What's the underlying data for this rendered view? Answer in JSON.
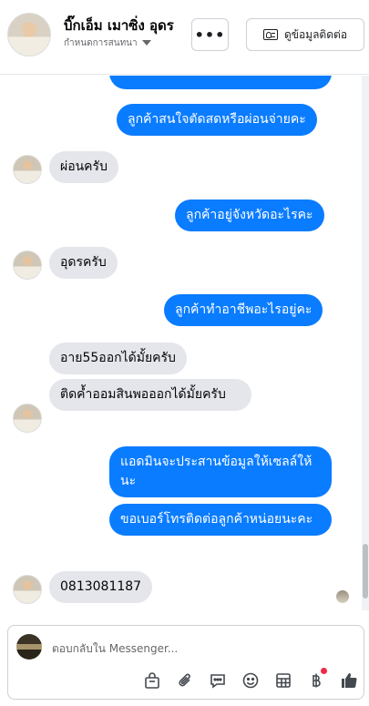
{
  "header": {
    "name": "บิ๊กเอ็ม เมาซิ่ง อุดร",
    "status": "กำหนดการสนทนา",
    "more_label": "•••",
    "contact_label": "ดูข้อมูลติดต่อ"
  },
  "messages": [
    {
      "dir": "out",
      "text": "ลูกค้าสนใจตัดสดหรือผ่อนจ่ายคะ"
    },
    {
      "dir": "in",
      "text": "ผ่อนครับ"
    },
    {
      "dir": "out",
      "text": "ลูกค้าอยู่จังหวัดอะไรคะ"
    },
    {
      "dir": "in",
      "text": "อุดรครับ"
    },
    {
      "dir": "out",
      "text": "ลูกค้าทำอาชีพอะไรอยู่คะ"
    },
    {
      "dir": "in",
      "text": "อาย55ออกได้มั้ยครับ"
    },
    {
      "dir": "in",
      "text": "ติดค้ำออมสินพอออกได้มั้ยครับ"
    },
    {
      "dir": "out",
      "text": "แอดมินจะประสานข้อมูลให้เซลล์ให้นะ"
    },
    {
      "dir": "out",
      "text": "ขอเบอร์โทรติดต่อลูกค้าหน่อยนะคะ"
    },
    {
      "dir": "in",
      "text": "0813081187"
    }
  ],
  "composer": {
    "placeholder": "ตอบกลับใน Messenger..."
  },
  "toolbar": {
    "icons": [
      "shopping-bag-icon",
      "paperclip-icon",
      "speech-bubble-icon",
      "emoji-icon",
      "table-icon",
      "baht-icon",
      "thumbs-up-icon"
    ]
  },
  "colors": {
    "outgoing_bubble": "#0a7cff",
    "incoming_bubble": "#e4e6eb",
    "badge": "#f02849"
  }
}
